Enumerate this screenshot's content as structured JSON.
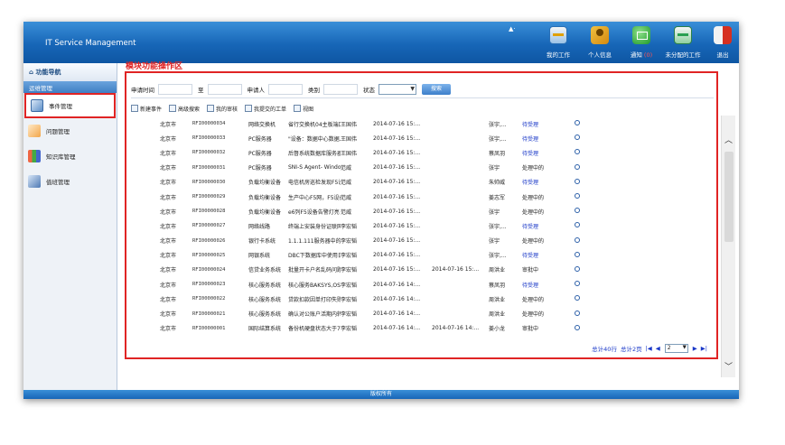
{
  "header": {
    "title": "IT Service Management",
    "user_indicator": "▲·",
    "buttons": [
      {
        "label": "我的工作",
        "icon": "work-icon"
      },
      {
        "label": "个人信息",
        "icon": "user-info-icon"
      },
      {
        "label": "通知",
        "count": "(0)",
        "icon": "notify-icon"
      },
      {
        "label": "未分配的工作",
        "icon": "unassigned-work-icon"
      },
      {
        "label": "退出",
        "icon": "exit-icon"
      }
    ]
  },
  "sidebar": {
    "title": "功能导航",
    "section": "运维管理",
    "items": [
      {
        "label": "事件管理"
      },
      {
        "label": "问题管理"
      },
      {
        "label": "知识库管理"
      },
      {
        "label": "值班管理"
      }
    ]
  },
  "main": {
    "module_label": "模块功能操作区",
    "filter": {
      "apply_time": "申请时间",
      "to": "至",
      "applicant": "申请人",
      "category": "类别",
      "status": "状态",
      "search": "搜索"
    },
    "toolbar": {
      "new_event": "新建事件",
      "advanced_search": "高级搜索",
      "my_review": "我的审核",
      "my_submitted": "我提交的工单",
      "view": "视图"
    },
    "rows": [
      {
        "city": "北京市",
        "id": "RFI00000034",
        "category": "网络交换机",
        "desc": "省行交换机04主板端口Gi...",
        "person": "王国伟",
        "time1": "2014-07-16 15:...",
        "time2": "",
        "assignee": "张宇,...",
        "status": "待受理",
        "link": true
      },
      {
        "city": "北京市",
        "id": "RFI00000033",
        "category": "PC服务器",
        "desc": "\"设备：数据中心数据...",
        "person": "王国伟",
        "time1": "2014-07-16 15:...",
        "time2": "",
        "assignee": "张宇,...",
        "status": "待受理",
        "link": true
      },
      {
        "city": "北京市",
        "id": "RFI00000032",
        "category": "PC服务器",
        "desc": "后督系统数据库服务器...",
        "person": "王国伟",
        "time1": "2014-07-16 15:...",
        "time2": "",
        "assignee": "蔡凤羽",
        "status": "待受理",
        "link": true
      },
      {
        "city": "北京市",
        "id": "RFI00000031",
        "category": "PC服务器",
        "desc": "SNI-S Agent- Windows...",
        "person": "范威",
        "time1": "2014-07-16 15:...",
        "time2": "",
        "assignee": "张宇",
        "status": "处理中的",
        "link": false
      },
      {
        "city": "北京市",
        "id": "RFI00000030",
        "category": "负载均衡设备",
        "desc": "电信机房巡检发现F5设...",
        "person": "范威",
        "time1": "2014-07-16 15:...",
        "time2": "",
        "assignee": "朱帅威",
        "status": "待受理",
        "link": true
      },
      {
        "city": "北京市",
        "id": "RFI00000029",
        "category": "负载均衡设备",
        "desc": "生产中心F5网，F5设备...",
        "person": "范威",
        "time1": "2014-07-16 15:...",
        "time2": "",
        "assignee": "姜志军",
        "status": "处理中的",
        "link": false
      },
      {
        "city": "北京市",
        "id": "RFI00000028",
        "category": "负载均衡设备",
        "desc": "e6列F5设备告警灯亮",
        "person": "范威",
        "time1": "2014-07-16 15:...",
        "time2": "",
        "assignee": "张宇",
        "status": "处理中的",
        "link": false
      },
      {
        "city": "北京市",
        "id": "RFI00000027",
        "category": "网络线路",
        "desc": "终端上安装身份证联网...",
        "person": "李宏韬",
        "time1": "2014-07-16 15:...",
        "time2": "",
        "assignee": "张宇,...",
        "status": "待受理",
        "link": true
      },
      {
        "city": "北京市",
        "id": "RFI00000026",
        "category": "银行卡系统",
        "desc": "1.1.1.111服务器中的3...",
        "person": "李宏韬",
        "time1": "2014-07-16 15:...",
        "time2": "",
        "assignee": "张宇",
        "status": "处理中的",
        "link": false
      },
      {
        "city": "北京市",
        "id": "RFI00000025",
        "category": "网银系统",
        "desc": "DBC下数据库中使用日...",
        "person": "李宏韬",
        "time1": "2014-07-16 15:...",
        "time2": "",
        "assignee": "张宇,...",
        "status": "待受理",
        "link": true
      },
      {
        "city": "北京市",
        "id": "RFI00000024",
        "category": "信贷业务系统",
        "desc": "批量开卡户名乱码问题",
        "person": "李宏韬",
        "time1": "2014-07-16 15:...",
        "time2": "2014-07-16 15:...",
        "assignee": "周洪业",
        "status": "审批中",
        "link": false
      },
      {
        "city": "北京市",
        "id": "RFI00000023",
        "category": "核心服务系统",
        "desc": "核心服务BAKSYS,OS400...",
        "person": "李宏韬",
        "time1": "2014-07-16 14:...",
        "time2": "",
        "assignee": "蔡凤羽",
        "status": "待受理",
        "link": true
      },
      {
        "city": "北京市",
        "id": "RFI00000022",
        "category": "核心服务系统",
        "desc": "贷款扣款因单打印失败",
        "person": "李宏韬",
        "time1": "2014-07-16 14:...",
        "time2": "",
        "assignee": "周洪业",
        "status": "处理中的",
        "link": false
      },
      {
        "city": "北京市",
        "id": "RFI00000021",
        "category": "核心服务系统",
        "desc": "确认对公账户活期内转...",
        "person": "李宏韬",
        "time1": "2014-07-16 14:...",
        "time2": "",
        "assignee": "周洪业",
        "status": "处理中的",
        "link": false
      },
      {
        "city": "北京市",
        "id": "RFI00000001",
        "category": "国际结算系统",
        "desc": "备份机硬盘状态大于70%",
        "person": "李宏韬",
        "time1": "2014-07-16 14:...",
        "time2": "2014-07-16 14:...",
        "assignee": "姜小龙",
        "status": "审批中",
        "link": false
      }
    ],
    "pager": {
      "total_rows": "总计40行",
      "total_pages": "总计2页",
      "first": "|◀",
      "prev": "◀",
      "current": "2",
      "next": "▶",
      "last": "▶|"
    }
  },
  "footer": {
    "text": "版权所有"
  }
}
